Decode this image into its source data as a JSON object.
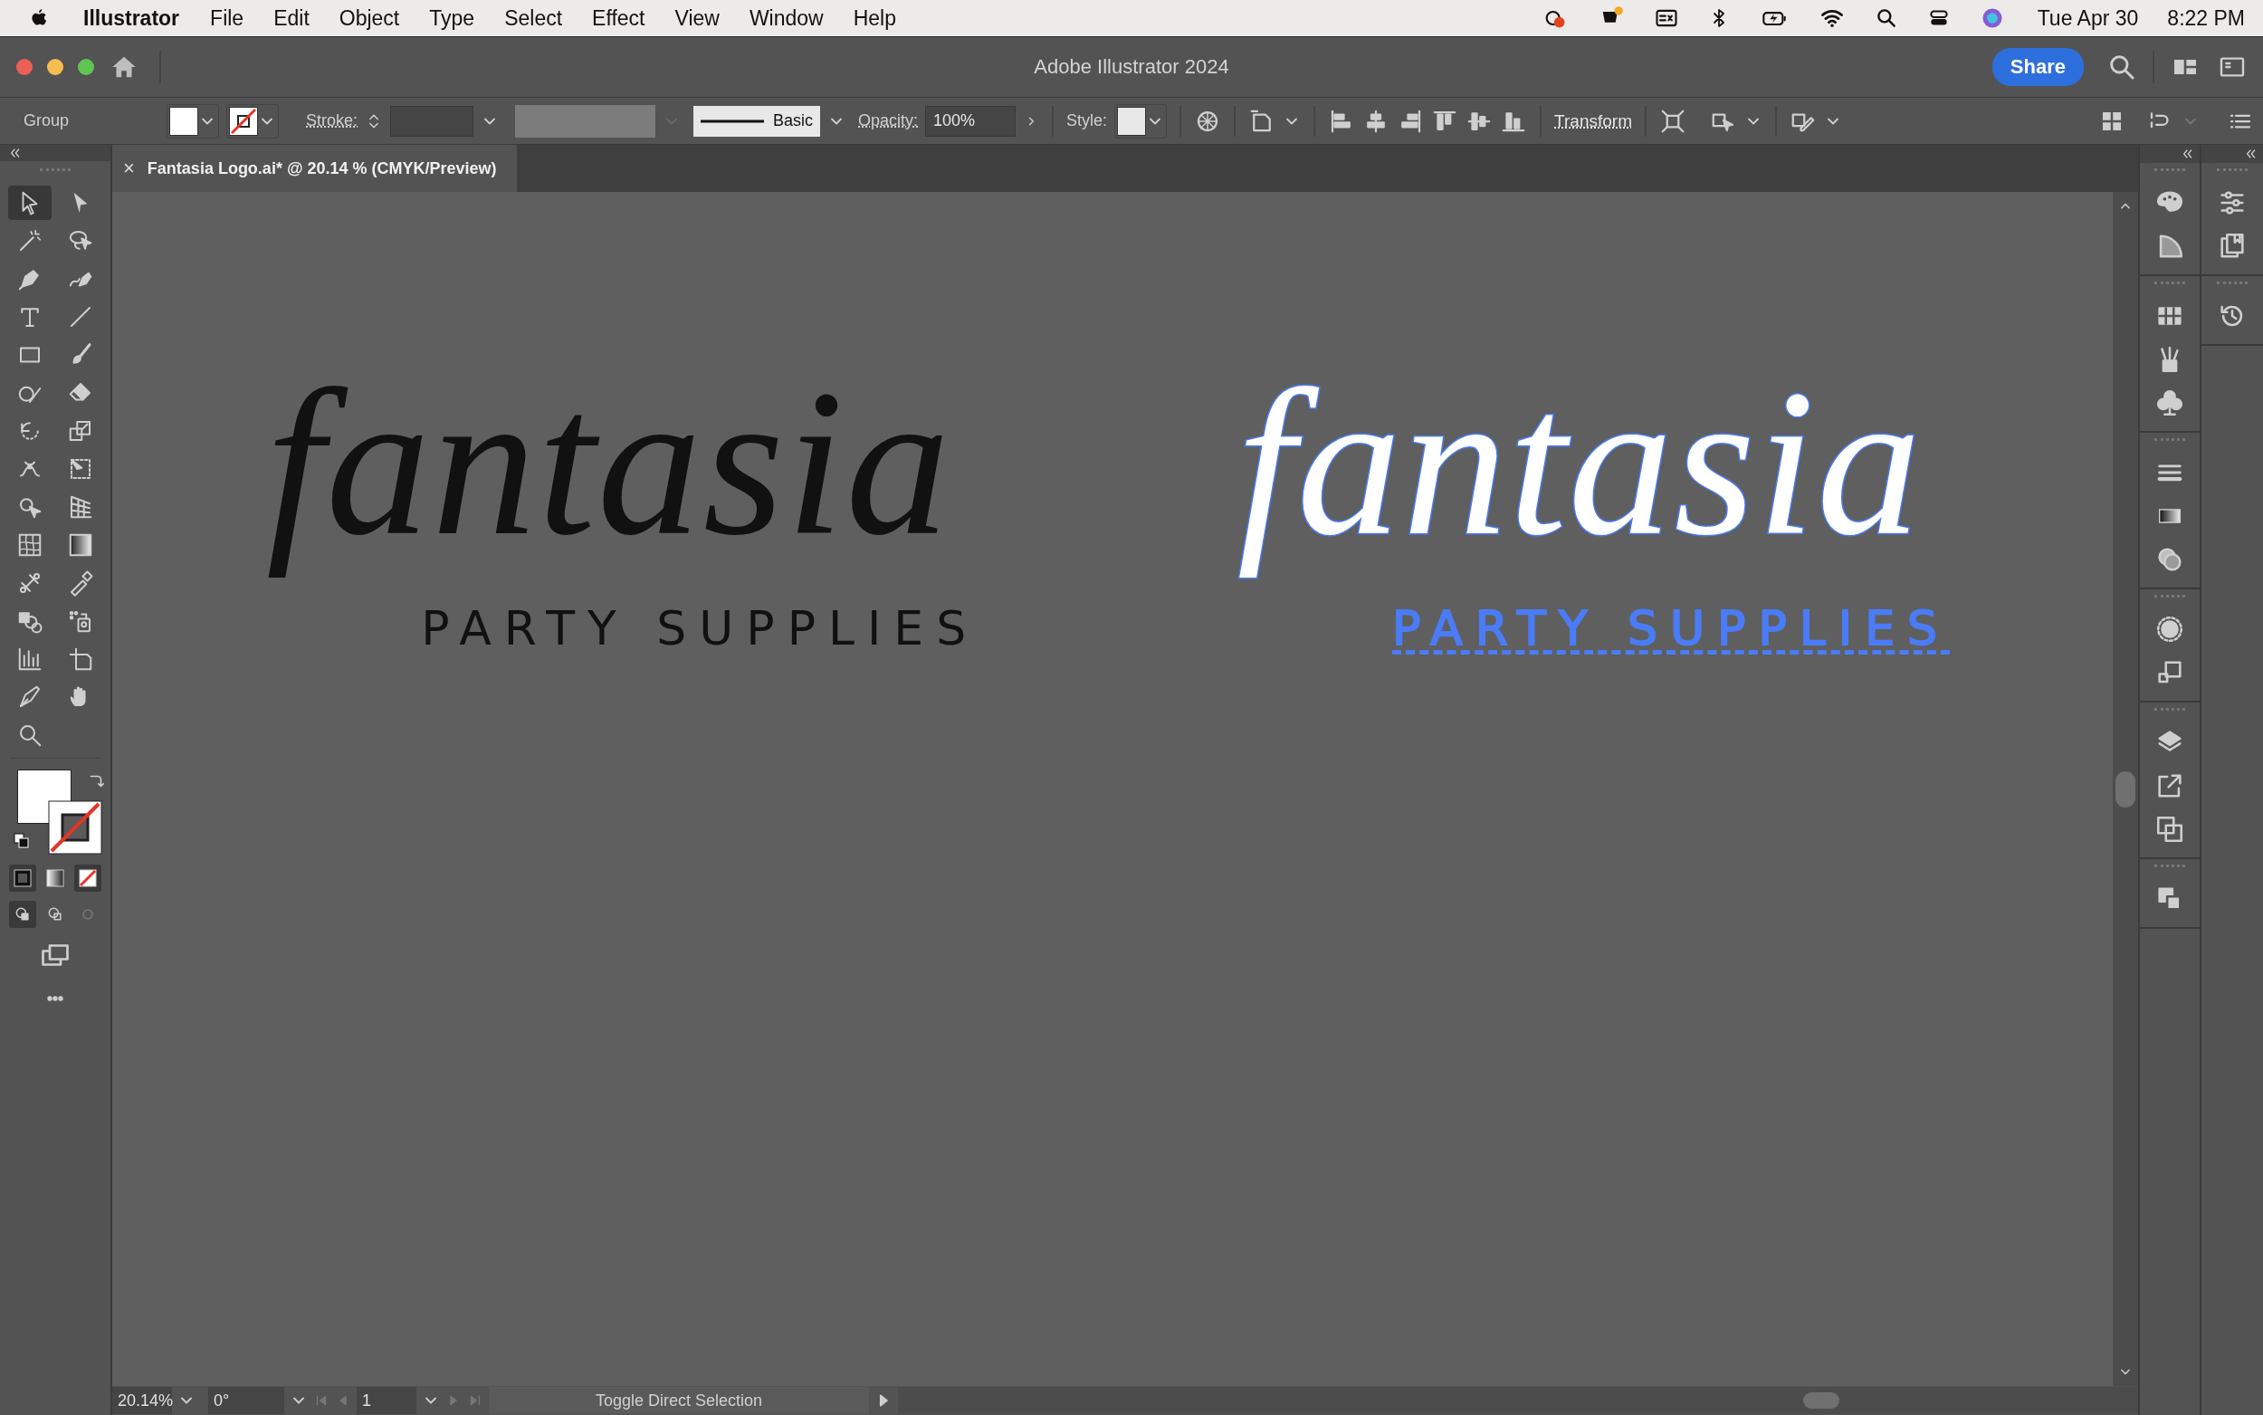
{
  "menu_bar": {
    "app_name": "Illustrator",
    "items": [
      "File",
      "Edit",
      "Object",
      "Type",
      "Select",
      "Effect",
      "View",
      "Window",
      "Help"
    ],
    "date": "Tue Apr 30",
    "time": "8:22 PM"
  },
  "title_bar": {
    "title": "Adobe Illustrator 2024",
    "share_button": "Share"
  },
  "control_bar": {
    "selection_label": "Group",
    "stroke_label": "Stroke:",
    "brush_label": "Basic",
    "opacity_label": "Opacity:",
    "opacity_value": "100%",
    "style_label": "Style:",
    "transform_button": "Transform"
  },
  "document_tab": {
    "close": "×",
    "title": "Fantasia Logo.ai* @ 20.14 % (CMYK/Preview)"
  },
  "toolbar": {
    "tools": [
      {
        "kind": "selection",
        "selected": true
      },
      {
        "kind": "direct-selection",
        "selected": false
      },
      {
        "kind": "magic-wand",
        "selected": false
      },
      {
        "kind": "lasso",
        "selected": false
      },
      {
        "kind": "pen",
        "selected": false
      },
      {
        "kind": "curvature",
        "selected": false
      },
      {
        "kind": "type",
        "selected": false
      },
      {
        "kind": "line",
        "selected": false
      },
      {
        "kind": "rectangle",
        "selected": false
      },
      {
        "kind": "paintbrush",
        "selected": false
      },
      {
        "kind": "shaper",
        "selected": false
      },
      {
        "kind": "eraser",
        "selected": false
      },
      {
        "kind": "rotate",
        "selected": false
      },
      {
        "kind": "scale",
        "selected": false
      },
      {
        "kind": "warp",
        "selected": false
      },
      {
        "kind": "free-transform",
        "selected": false
      },
      {
        "kind": "shape-builder",
        "selected": false
      },
      {
        "kind": "perspective",
        "selected": false
      },
      {
        "kind": "mesh",
        "selected": false
      },
      {
        "kind": "gradient",
        "selected": false
      },
      {
        "kind": "blend",
        "selected": false
      },
      {
        "kind": "eyedropper",
        "selected": false
      },
      {
        "kind": "live-paint",
        "selected": false
      },
      {
        "kind": "sprayer",
        "selected": false
      },
      {
        "kind": "graph",
        "selected": false
      },
      {
        "kind": "artboard",
        "selected": false
      },
      {
        "kind": "knife",
        "selected": false
      },
      {
        "kind": "hand",
        "selected": false
      },
      {
        "kind": "zoom",
        "selected": false
      }
    ]
  },
  "artwork": {
    "logos": [
      {
        "script": "fantasia",
        "tagline": "PARTY SUPPLIES",
        "selected": false
      },
      {
        "script": "fantasia",
        "tagline": "PARTY SUPPLIES",
        "selected": true
      }
    ]
  },
  "status_bar": {
    "zoom": "20.14%",
    "rotation": "0°",
    "artboard": "1",
    "status_text": "Toggle Direct Selection"
  }
}
